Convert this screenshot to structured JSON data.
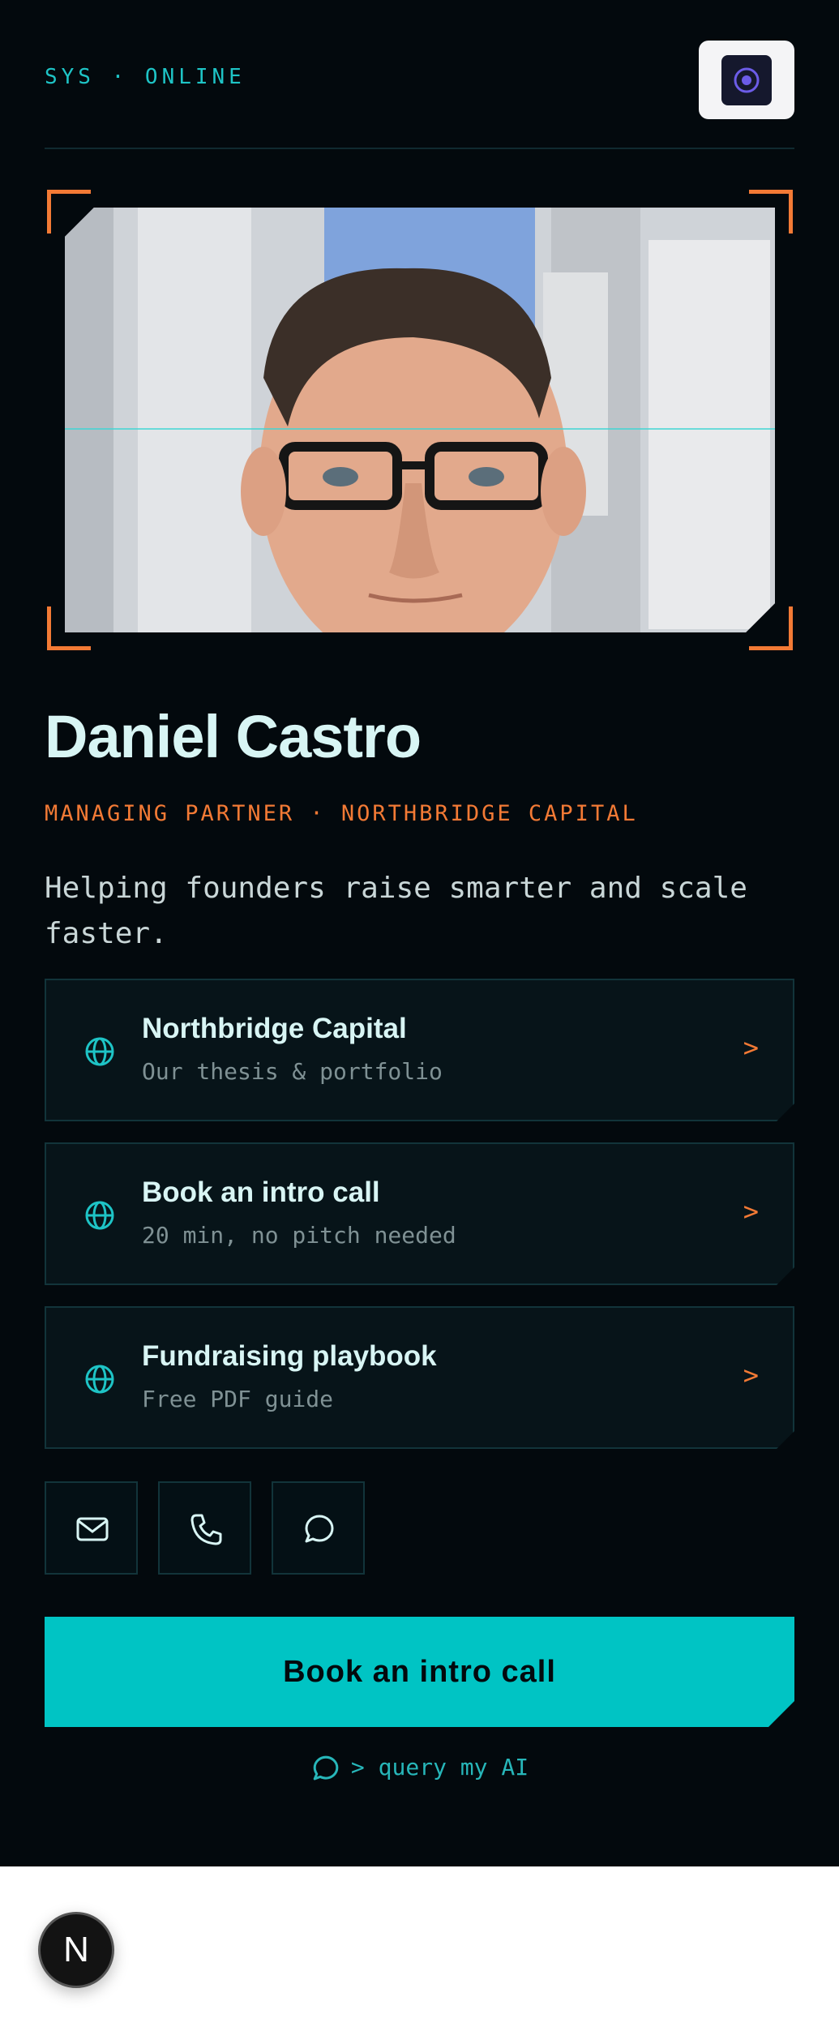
{
  "header": {
    "status": "SYS · ONLINE"
  },
  "profile": {
    "name": "Daniel Castro",
    "role": "MANAGING PARTNER · NORTHBRIDGE CAPITAL",
    "tagline": "Helping founders raise smarter and scale faster."
  },
  "links": [
    {
      "title": "Northbridge Capital",
      "subtitle": "Our thesis & portfolio",
      "arrow": ">"
    },
    {
      "title": "Book an intro call",
      "subtitle": "20 min, no pitch needed",
      "arrow": ">"
    },
    {
      "title": "Fundraising playbook",
      "subtitle": "Free PDF guide",
      "arrow": ">"
    }
  ],
  "contact_icons": [
    "mail-icon",
    "phone-icon",
    "chat-icon"
  ],
  "cta": {
    "label": "Book an intro call"
  },
  "ai": {
    "label": "> query my AI"
  },
  "badge": {
    "letter": "N"
  },
  "colors": {
    "accent": "#00c4c4",
    "orange": "#f37a35",
    "background": "#03090d"
  }
}
